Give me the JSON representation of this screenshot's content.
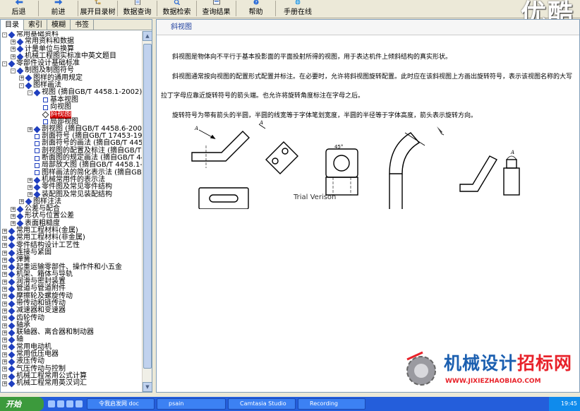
{
  "toolbar": {
    "buttons": [
      "后退",
      "前进",
      "展开目录树",
      "数据查询",
      "数据检索",
      "查询结果",
      "帮助",
      "手册在线"
    ]
  },
  "watermark": "优酷",
  "left_tabs": [
    "目录",
    "索引",
    "模糊",
    "书签"
  ],
  "tree": [
    {
      "pm": "-",
      "icon": "book",
      "label": "常用基础资料",
      "indent": 0
    },
    {
      "pm": "+",
      "icon": "book",
      "label": "常用资料和数据",
      "indent": 1
    },
    {
      "pm": "+",
      "icon": "book",
      "label": "计量单位与换算",
      "indent": 1
    },
    {
      "pm": "+",
      "icon": "book",
      "label": "机械工程图实标准中英文题目",
      "indent": 1
    },
    {
      "pm": "-",
      "icon": "book",
      "label": "零部件设计基础标准",
      "indent": 0
    },
    {
      "pm": "-",
      "icon": "book",
      "label": "制图及制图符号",
      "indent": 1
    },
    {
      "pm": "+",
      "icon": "book",
      "label": "图样的通用规定",
      "indent": 2
    },
    {
      "pm": "-",
      "icon": "book",
      "label": "图样画法",
      "indent": 2
    },
    {
      "pm": "-",
      "icon": "book",
      "label": "视图 (摘自GB/T 4458.1-2002)",
      "indent": 3
    },
    {
      "pm": "",
      "icon": "page",
      "label": "基本视图",
      "indent": 4
    },
    {
      "pm": "",
      "icon": "page",
      "label": "向视图",
      "indent": 4
    },
    {
      "pm": "",
      "icon": "open",
      "label": "斜视图",
      "indent": 4,
      "selected": true
    },
    {
      "pm": "",
      "icon": "page",
      "label": "局部视图",
      "indent": 4
    },
    {
      "pm": "+",
      "icon": "book",
      "label": "剖视图 (摘自GB/T 4458.6-2002)",
      "indent": 3
    },
    {
      "pm": "",
      "icon": "page",
      "label": "剖面符号 (摘自GB/T 17453-1998)",
      "indent": 3
    },
    {
      "pm": "",
      "icon": "page",
      "label": "剖面符号的画法 (摘自GB/T 4457.",
      "indent": 3
    },
    {
      "pm": "",
      "icon": "page",
      "label": "剖视图的配置及标注 (摘自GB/T 4",
      "indent": 3
    },
    {
      "pm": "",
      "icon": "page",
      "label": "断面图的规定画法 (摘自GB/T 445",
      "indent": 3
    },
    {
      "pm": "",
      "icon": "page",
      "label": "局部放大图 (摘自GB/T 4458.1-20",
      "indent": 3
    },
    {
      "pm": "",
      "icon": "page",
      "label": "图样画法的简化表示法 (摘自GB/T",
      "indent": 3
    },
    {
      "pm": "+",
      "icon": "book",
      "label": "机械常用件的表示法",
      "indent": 3
    },
    {
      "pm": "+",
      "icon": "book",
      "label": "零件图及常见零件结构",
      "indent": 3
    },
    {
      "pm": "+",
      "icon": "book",
      "label": "装配图及常见装配结构",
      "indent": 3
    },
    {
      "pm": "+",
      "icon": "book",
      "label": "图样注法",
      "indent": 2
    },
    {
      "pm": "+",
      "icon": "book",
      "label": "公差与配合",
      "indent": 1
    },
    {
      "pm": "+",
      "icon": "book",
      "label": "形状与位置公差",
      "indent": 1
    },
    {
      "pm": "+",
      "icon": "book",
      "label": "表面粗糙度",
      "indent": 1
    },
    {
      "pm": "+",
      "icon": "book",
      "label": "常用工程材料(金属)",
      "indent": 0
    },
    {
      "pm": "+",
      "icon": "book",
      "label": "常用工程材料(非金属)",
      "indent": 0
    },
    {
      "pm": "+",
      "icon": "book",
      "label": "零件结构设计工艺性",
      "indent": 0
    },
    {
      "pm": "+",
      "icon": "book",
      "label": "连接与紧固",
      "indent": 0
    },
    {
      "pm": "+",
      "icon": "book",
      "label": "弹簧",
      "indent": 0
    },
    {
      "pm": "+",
      "icon": "book",
      "label": "起重运输零部件、操作件和小五金",
      "indent": 0
    },
    {
      "pm": "+",
      "icon": "book",
      "label": "机架、箱体与导轨",
      "indent": 0
    },
    {
      "pm": "+",
      "icon": "book",
      "label": "润滑与密封装置",
      "indent": 0
    },
    {
      "pm": "+",
      "icon": "book",
      "label": "管道与管道附件",
      "indent": 0
    },
    {
      "pm": "+",
      "icon": "book",
      "label": "摩擦轮及螺旋传动",
      "indent": 0
    },
    {
      "pm": "+",
      "icon": "book",
      "label": "带传动和链传动",
      "indent": 0
    },
    {
      "pm": "+",
      "icon": "book",
      "label": "减速器和变速器",
      "indent": 0
    },
    {
      "pm": "+",
      "icon": "book",
      "label": "齿轮传动",
      "indent": 0
    },
    {
      "pm": "+",
      "icon": "book",
      "label": "轴承",
      "indent": 0
    },
    {
      "pm": "+",
      "icon": "book",
      "label": "联轴器、离合器和制动器",
      "indent": 0
    },
    {
      "pm": "+",
      "icon": "book",
      "label": "轴",
      "indent": 0
    },
    {
      "pm": "+",
      "icon": "book",
      "label": "常用电动机",
      "indent": 0
    },
    {
      "pm": "+",
      "icon": "book",
      "label": "常用低压电器",
      "indent": 0
    },
    {
      "pm": "+",
      "icon": "book",
      "label": "液压传动",
      "indent": 0
    },
    {
      "pm": "+",
      "icon": "book",
      "label": "气压传动与控制",
      "indent": 0
    },
    {
      "pm": "+",
      "icon": "book",
      "label": "机械工程常用公式计算",
      "indent": 0
    },
    {
      "pm": "+",
      "icon": "book",
      "label": "机械工程常用英汉词汇",
      "indent": 0
    }
  ],
  "content": {
    "title": "斜视图",
    "paragraphs": [
      "斜视图是物体向不平行于基本投影面的平面投射所得的视图，用于表达机件上倾斜结构的真实形状。",
      "斜视图通常按向视图的配置形式配置并标注。在必要时，允许将斜视图旋转配置。此时应在该斜视图上方画出旋转符号，表示该视图名称的大写拉丁字母应靠近旋转符号的箭头端。也允许将旋转角度标注在字母之后。",
      "旋转符号为带有箭头的半圆，半圆的线宽等于字体笔划宽度，半圆的半径等于字体高度，箭头表示旋转方向。"
    ],
    "trial_text": "Trial Verison",
    "drawing_labels": {
      "a": "A",
      "angle": "45°"
    }
  },
  "brand": {
    "name_a": "机械设计",
    "name_b": "招标网",
    "url": "WWW.JIXIEZHAOBIAO.COM"
  },
  "taskbar": {
    "start": "开始",
    "tasks": [
      "令我启发网 doc",
      "psain",
      "Camtasia Studio",
      "Recording"
    ],
    "clock": "19:45"
  }
}
